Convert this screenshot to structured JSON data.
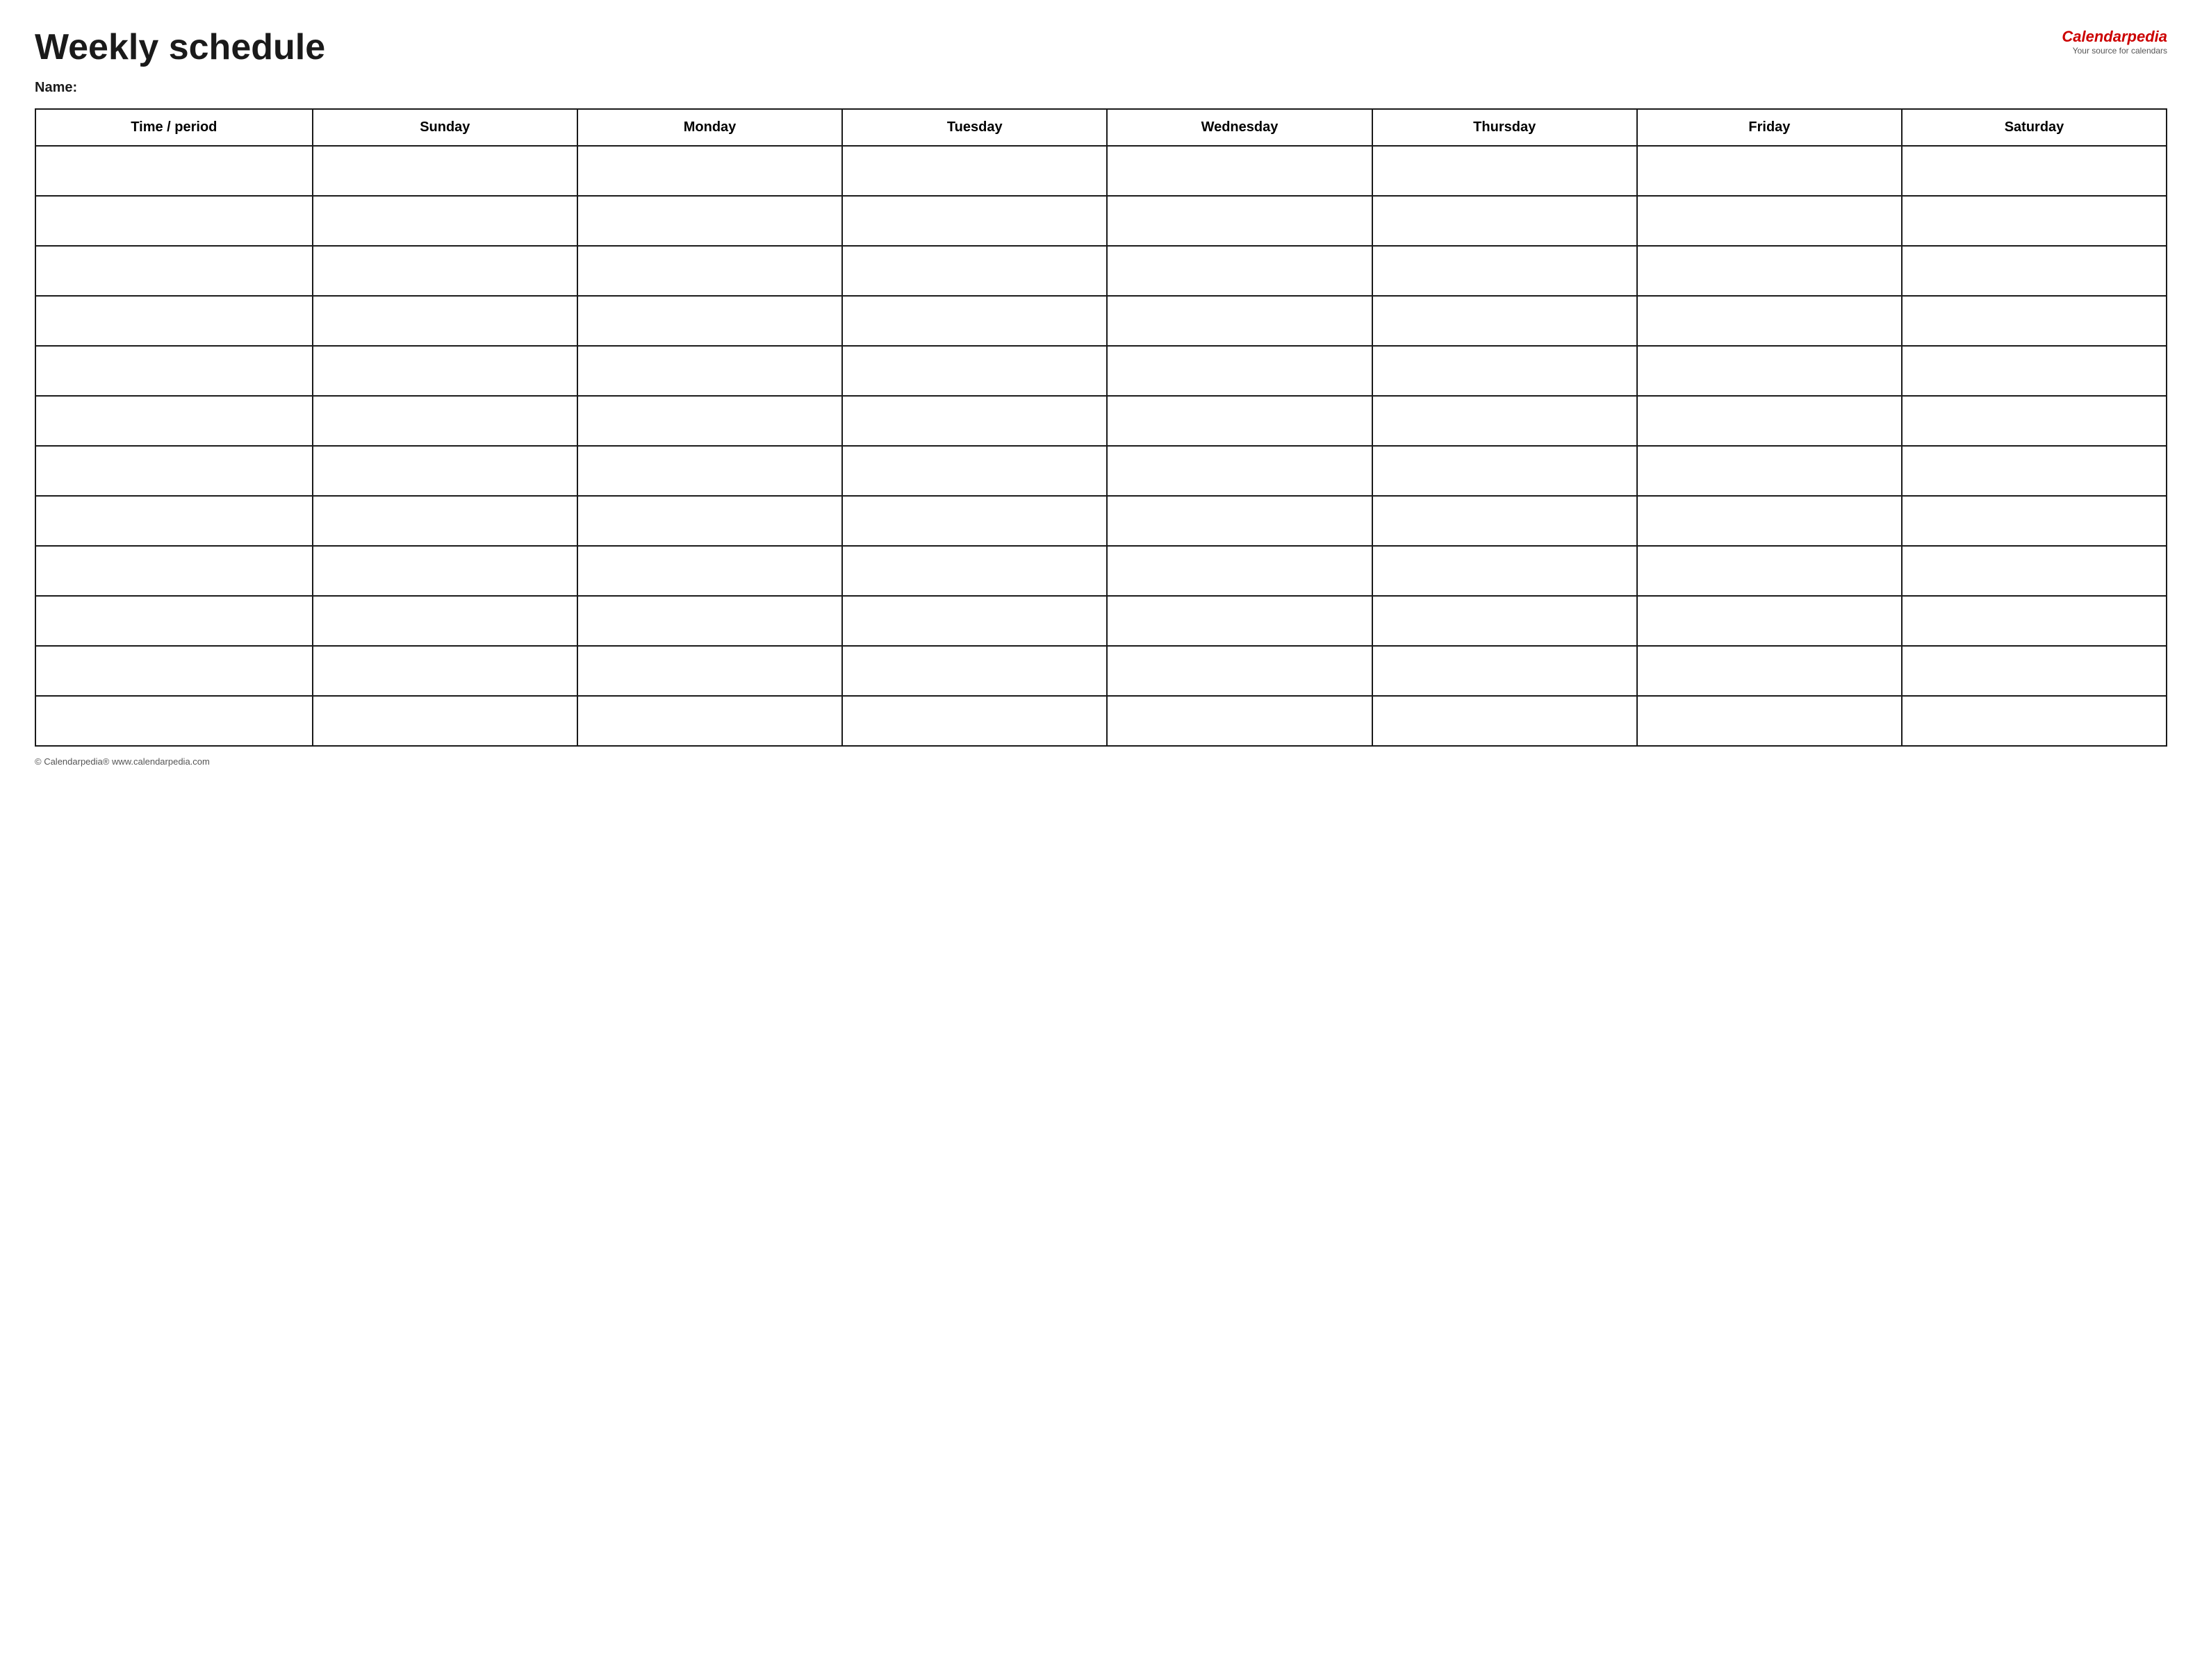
{
  "header": {
    "title": "Weekly schedule",
    "brand": {
      "name_regular": "Calendar",
      "name_italic": "pedia",
      "tagline": "Your source for calendars"
    }
  },
  "name_section": {
    "label": "Name:"
  },
  "table": {
    "columns": [
      {
        "id": "time",
        "label": "Time / period"
      },
      {
        "id": "sunday",
        "label": "Sunday"
      },
      {
        "id": "monday",
        "label": "Monday"
      },
      {
        "id": "tuesday",
        "label": "Tuesday"
      },
      {
        "id": "wednesday",
        "label": "Wednesday"
      },
      {
        "id": "thursday",
        "label": "Thursday"
      },
      {
        "id": "friday",
        "label": "Friday"
      },
      {
        "id": "saturday",
        "label": "Saturday"
      }
    ],
    "row_count": 12
  },
  "footer": {
    "text": "© Calendarpedia®  www.calendarpedia.com"
  }
}
